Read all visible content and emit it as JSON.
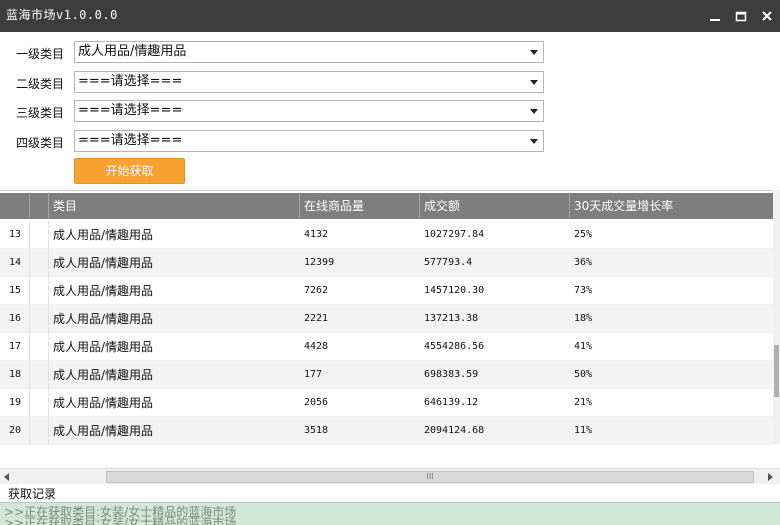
{
  "window": {
    "title": "蓝海市场v1.0.0.0",
    "minimize_glyph": "minimize-icon",
    "maximize_glyph": "maximize-icon",
    "close_glyph": "close-icon"
  },
  "form": {
    "level1": {
      "label": "一级类目",
      "value": "成人用品/情趣用品"
    },
    "level2": {
      "label": "二级类目",
      "value": "===请选择==="
    },
    "level3": {
      "label": "三级类目",
      "value": "===请选择==="
    },
    "level4": {
      "label": "四级类目",
      "value": "===请选择==="
    },
    "start_button": "开始获取"
  },
  "table": {
    "columns": [
      "类目",
      "在线商品量",
      "成交额",
      "30天成交量增长率"
    ],
    "rows": [
      {
        "index": "13",
        "category": "成人用品/情趣用品",
        "online_count": "4132",
        "turnover": "1027297.84",
        "growth": "25%"
      },
      {
        "index": "14",
        "category": "成人用品/情趣用品",
        "online_count": "12399",
        "turnover": "577793.4",
        "growth": "36%"
      },
      {
        "index": "15",
        "category": "成人用品/情趣用品",
        "online_count": "7262",
        "turnover": "1457120.30",
        "growth": "73%"
      },
      {
        "index": "16",
        "category": "成人用品/情趣用品",
        "online_count": "2221",
        "turnover": "137213.38",
        "growth": "18%"
      },
      {
        "index": "17",
        "category": "成人用品/情趣用品",
        "online_count": "4428",
        "turnover": "4554286.56",
        "growth": "41%"
      },
      {
        "index": "18",
        "category": "成人用品/情趣用品",
        "online_count": "177",
        "turnover": "698383.59",
        "growth": "50%"
      },
      {
        "index": "19",
        "category": "成人用品/情趣用品",
        "online_count": "2056",
        "turnover": "646139.12",
        "growth": "21%"
      },
      {
        "index": "20",
        "category": "成人用品/情趣用品",
        "online_count": "3518",
        "turnover": "2094124.68",
        "growth": "11%"
      }
    ]
  },
  "hscroll": {
    "grip": "III"
  },
  "log": {
    "label": "获取记录",
    "lines": [
      ">>正在获取类目:女装/女士精品的蓝海市场",
      ">>正在获取类目:女装/女士精品的蓝海市场"
    ]
  },
  "colors": {
    "titlebar": "#3d3d3d",
    "header": "#7e7e7e",
    "button": "#f7a230",
    "log_bg": "#cfe8d8"
  }
}
